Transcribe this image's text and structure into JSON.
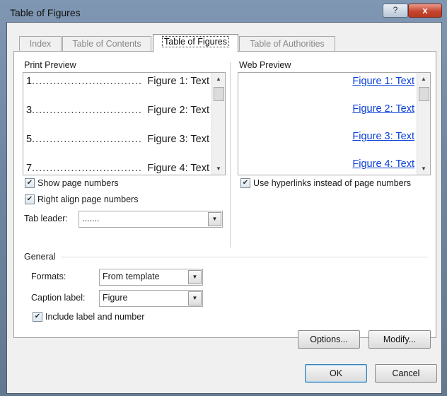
{
  "window": {
    "title": "Table of Figures",
    "help_glyph": "?",
    "close_glyph": "x"
  },
  "tabs": [
    {
      "label": "Index",
      "active": false
    },
    {
      "label": "Table of Contents",
      "active": false
    },
    {
      "label": "Table of Figures",
      "active": true
    },
    {
      "label": "Table of Authorities",
      "active": false
    }
  ],
  "print_preview": {
    "label": "Print Preview",
    "rows": [
      {
        "page": "1",
        "leader": "...............................",
        "text": "Figure 1: Text"
      },
      {
        "page": "3",
        "leader": "...............................",
        "text": "Figure 2: Text"
      },
      {
        "page": "5",
        "leader": "...............................",
        "text": "Figure 3: Text"
      },
      {
        "page": "7",
        "leader": "...............................",
        "text": "Figure 4: Text"
      }
    ]
  },
  "web_preview": {
    "label": "Web Preview",
    "links": [
      "Figure 1: Text",
      "Figure 2: Text",
      "Figure 3: Text",
      "Figure 4: Text"
    ]
  },
  "options": {
    "show_page_numbers": {
      "label": "Show page numbers",
      "checked": true
    },
    "right_align": {
      "label": "Right align page numbers",
      "checked": true
    },
    "use_hyperlinks": {
      "label": "Use hyperlinks instead of page numbers",
      "checked": true
    },
    "tab_leader": {
      "label": "Tab leader:",
      "value": "......."
    }
  },
  "general": {
    "label": "General",
    "formats": {
      "label": "Formats:",
      "value": "From template"
    },
    "caption_label": {
      "label": "Caption label:",
      "value": "Figure"
    },
    "include_label": {
      "label": "Include label and number",
      "checked": true
    }
  },
  "buttons": {
    "options": "Options...",
    "modify": "Modify...",
    "ok": "OK",
    "cancel": "Cancel"
  },
  "icons": {
    "check": "check-icon",
    "dropdown": "dropdown-arrow-icon",
    "scroll_up": "scroll-up-icon",
    "scroll_down": "scroll-down-icon"
  }
}
